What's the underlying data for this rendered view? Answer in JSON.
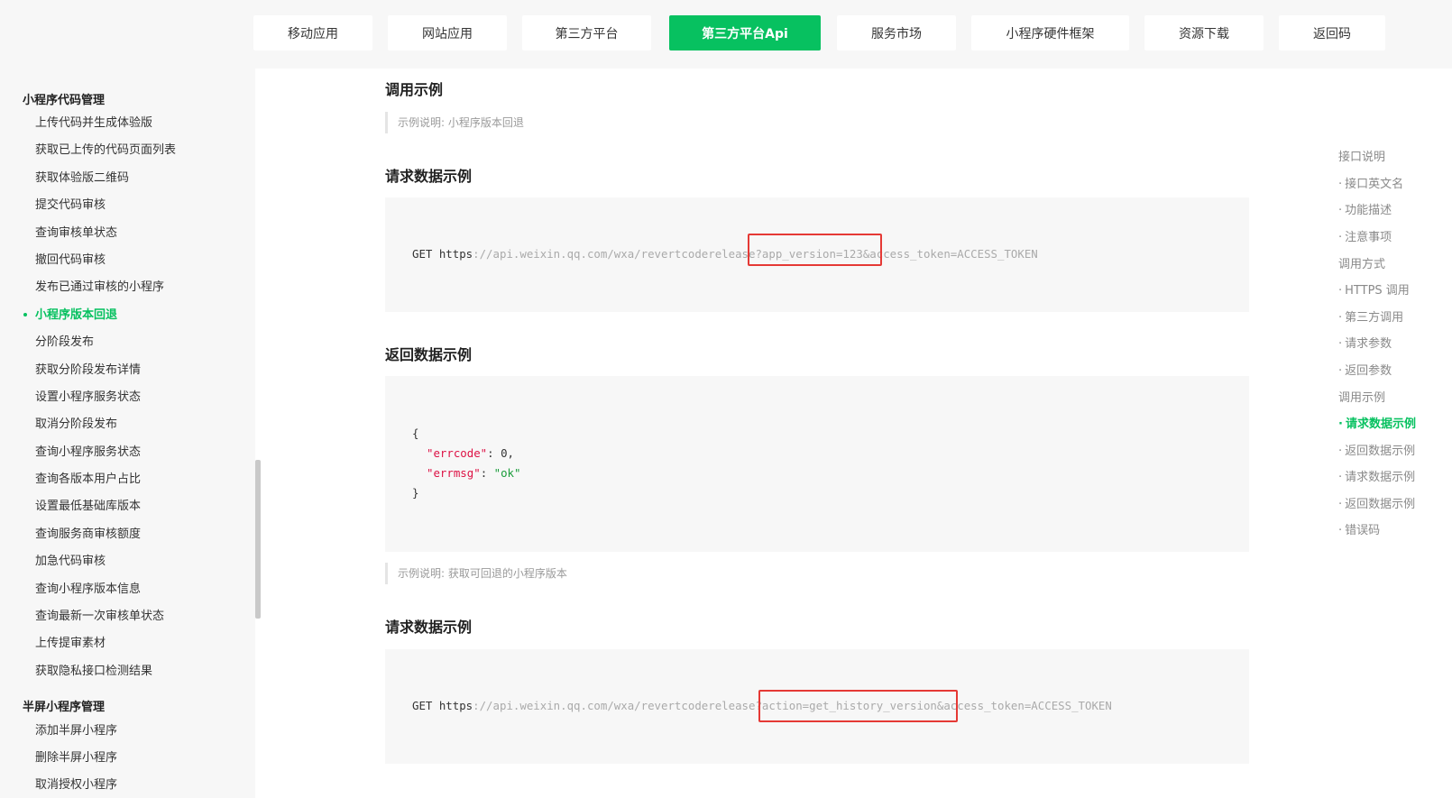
{
  "nav": {
    "tabs": [
      {
        "label": "移动应用"
      },
      {
        "label": "网站应用"
      },
      {
        "label": "第三方平台"
      },
      {
        "label": "第三方平台Api",
        "active": true
      },
      {
        "label": "服务市场"
      },
      {
        "label": "小程序硬件框架"
      },
      {
        "label": "资源下载"
      },
      {
        "label": "返回码"
      }
    ]
  },
  "sidebar": {
    "group1": "小程序代码管理",
    "items": [
      "上传代码并生成体验版",
      "获取已上传的代码页面列表",
      "获取体验版二维码",
      "提交代码审核",
      "查询审核单状态",
      "撤回代码审核",
      "发布已通过审核的小程序",
      "小程序版本回退",
      "分阶段发布",
      "获取分阶段发布详情",
      "设置小程序服务状态",
      "取消分阶段发布",
      "查询小程序服务状态",
      "查询各版本用户占比",
      "设置最低基础库版本",
      "查询服务商审核额度",
      "加急代码审核",
      "查询小程序版本信息",
      "查询最新一次审核单状态",
      "上传提审素材",
      "获取隐私接口检测结果"
    ],
    "active_index": 7,
    "group2": "半屏小程序管理",
    "items2": [
      "添加半屏小程序",
      "删除半屏小程序",
      "取消授权小程序"
    ]
  },
  "content": {
    "section_title": "调用示例",
    "note1": "示例说明: 小程序版本回退",
    "req_title1": "请求数据示例",
    "req1": {
      "prefix": "GET https",
      "url_gray1": "://api.weixin.qq.com/wxa/revertcoderelease",
      "url_hl": "?app_version=123",
      "url_gray2": "&access_token=ACCESS_TOKEN"
    },
    "resp_title1": "返回数据示例",
    "resp1": {
      "open": "{",
      "k1": "\"errcode\"",
      "v1": "0",
      "k2": "\"errmsg\"",
      "v2": "\"ok\"",
      "close": "}"
    },
    "note2": "示例说明: 获取可回退的小程序版本",
    "req_title2": "请求数据示例",
    "req2": {
      "prefix": "GET https",
      "url_gray1": "://api.weixin.qq.com/wxa/revertcoderelease",
      "url_hl": "?action=get_history_version",
      "url_gray2": "&access_token=ACCESS_TOKEN"
    }
  },
  "toc": {
    "items": [
      {
        "label": "接口说明",
        "sub": false
      },
      {
        "label": "接口英文名",
        "sub": true
      },
      {
        "label": "功能描述",
        "sub": true
      },
      {
        "label": "注意事项",
        "sub": true
      },
      {
        "label": "调用方式",
        "sub": false
      },
      {
        "label": "HTTPS 调用",
        "sub": true
      },
      {
        "label": "第三方调用",
        "sub": true
      },
      {
        "label": "请求参数",
        "sub": true
      },
      {
        "label": "返回参数",
        "sub": true
      },
      {
        "label": "调用示例",
        "sub": false
      },
      {
        "label": "请求数据示例",
        "sub": true,
        "active": true
      },
      {
        "label": "返回数据示例",
        "sub": true
      },
      {
        "label": "请求数据示例",
        "sub": true
      },
      {
        "label": "返回数据示例",
        "sub": true
      },
      {
        "label": "错误码",
        "sub": true
      }
    ]
  },
  "colors": {
    "accent": "#07c160",
    "highlight_border": "#e53935"
  }
}
